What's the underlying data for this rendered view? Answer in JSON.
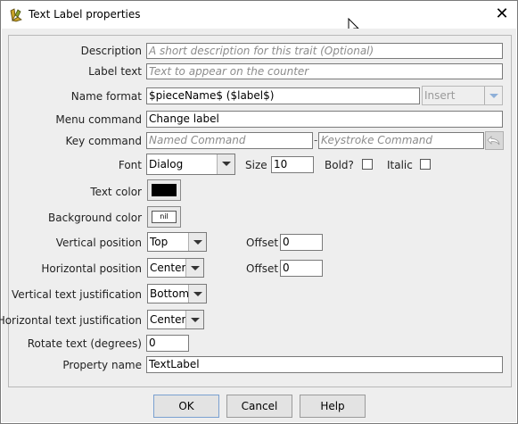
{
  "window": {
    "title": "Text Label properties"
  },
  "form": {
    "description": {
      "label": "Description",
      "placeholder": "A short description for this trait (Optional)"
    },
    "label_text": {
      "label": "Label text",
      "placeholder": "Text to appear on the counter"
    },
    "name_format": {
      "label": "Name format",
      "value": "$pieceName$ ($label$)",
      "insert": "Insert"
    },
    "menu_command": {
      "label": "Menu command",
      "value": "Change label"
    },
    "key_command": {
      "label": "Key command",
      "named_placeholder": "Named Command",
      "separator": "-",
      "keystroke_placeholder": "Keystroke Command"
    },
    "font": {
      "label": "Font",
      "value": "Dialog",
      "size_label": "Size",
      "size": "10",
      "bold_label": "Bold?",
      "italic_label": "Italic"
    },
    "text_color": {
      "label": "Text color",
      "color": "#000000"
    },
    "background_color": {
      "label": "Background color",
      "swatch_text": "nil"
    },
    "vertical_position": {
      "label": "Vertical position",
      "value": "Top",
      "offset_label": "Offset",
      "offset": "0"
    },
    "horizontal_position": {
      "label": "Horizontal position",
      "value": "Center",
      "offset_label": "Offset",
      "offset": "0"
    },
    "vertical_justification": {
      "label": "Vertical text justification",
      "value": "Bottom"
    },
    "horizontal_justification": {
      "label": "Horizontal text justification",
      "value": "Center"
    },
    "rotate": {
      "label": "Rotate text (degrees)",
      "value": "0"
    },
    "property_name": {
      "label": "Property name",
      "value": "TextLabel"
    }
  },
  "buttons": {
    "ok": "OK",
    "cancel": "Cancel",
    "help": "Help"
  },
  "icons": {
    "app": "vassal-app-icon",
    "close": "close-icon",
    "undo": "undo-icon"
  }
}
